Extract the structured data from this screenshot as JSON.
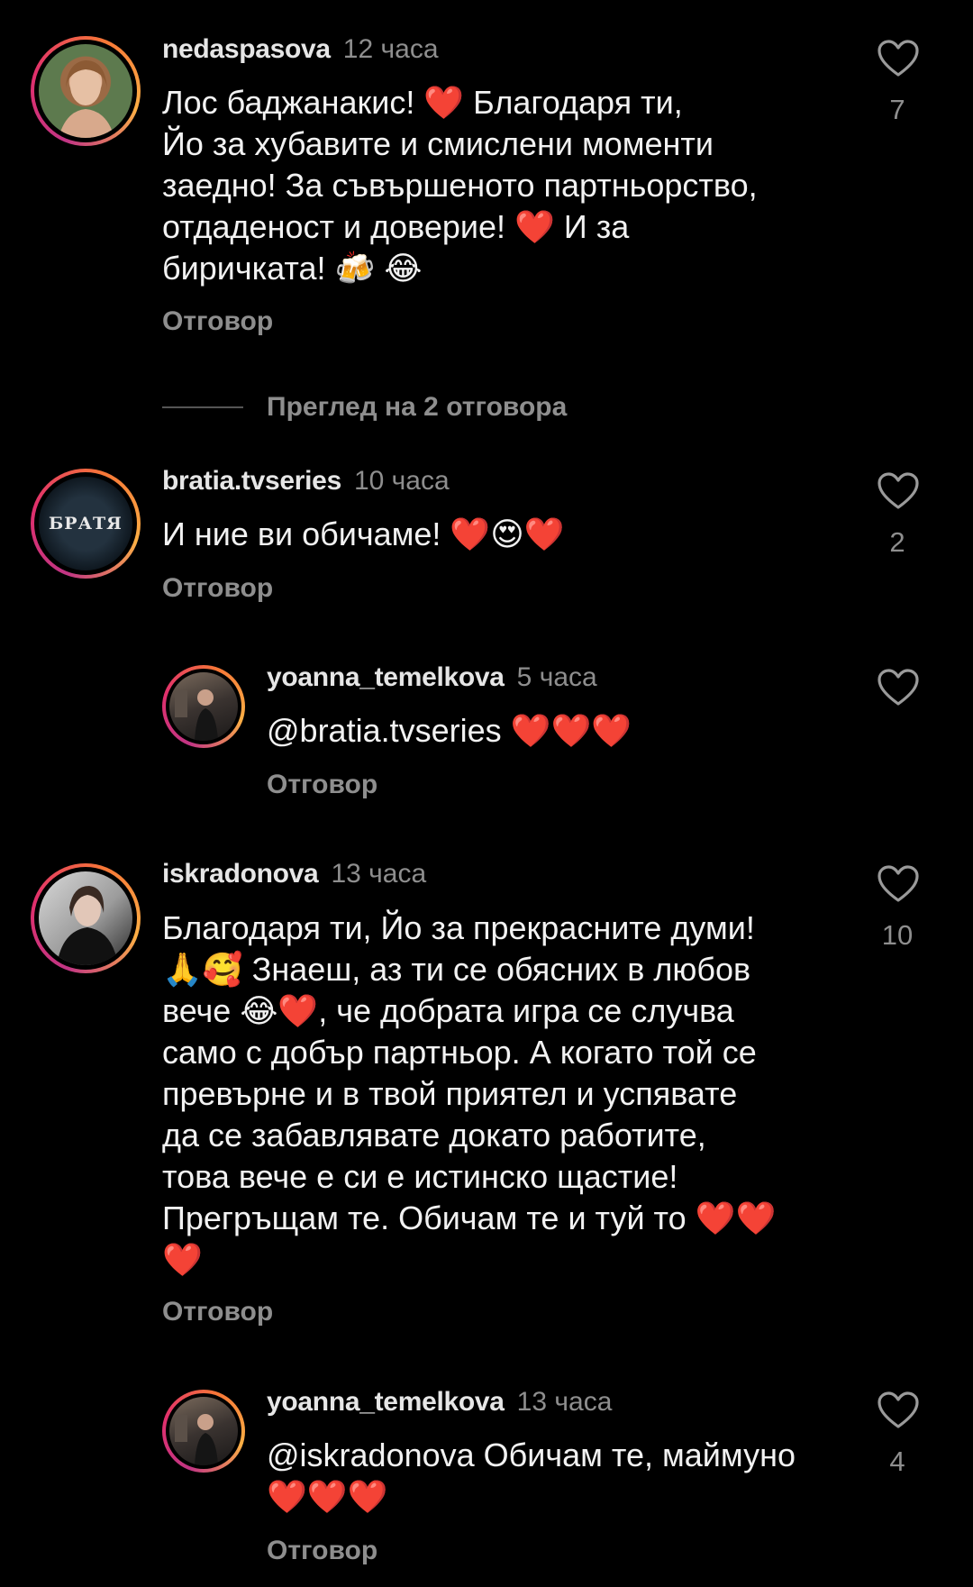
{
  "comments": [
    {
      "username": "nedaspasova",
      "time": "12 часа",
      "lines": [
        "Лос баджанакис! ❤️ Благодаря ти,",
        "Йо за хубавите и смислени моменти",
        "заедно! За съвършеното партньорство,",
        "отдаденост и доверие! ❤️ И за",
        "биричката! 🍻 😂"
      ],
      "reply_label": "Отговор",
      "likes": "7"
    },
    {
      "username": "bratia.tvseries",
      "time": "10 часа",
      "avatar_text": "БРАТЯ",
      "lines": [
        "И ние ви обичаме! ❤️😍❤️"
      ],
      "reply_label": "Отговор",
      "likes": "2"
    },
    {
      "username": "yoanna_temelkova",
      "time": "5 часа",
      "lines": [
        "@bratia.tvseries ❤️❤️❤️"
      ],
      "reply_label": "Отговор",
      "likes": ""
    },
    {
      "username": "iskradonova",
      "time": "13 часа",
      "lines": [
        "Благодаря ти, Йо за прекрасните думи!",
        "🙏🥰 Знаеш, аз ти се обясних в любов",
        "вече 😂❤️, че добрата игра се случва",
        "само с добър партньор. А когато той се",
        "превърне и в твой приятел и успявате",
        "да се забавлявате докато работите,",
        "това вече е си е истинско щастие!",
        "Прегръщам те. Обичам те и туй то ❤️❤️",
        "❤️"
      ],
      "reply_label": "Отговор",
      "likes": "10"
    },
    {
      "username": "yoanna_temelkova",
      "time": "13 часа",
      "lines": [
        "@iskradonova Обичам те, маймуно",
        "❤️❤️❤️"
      ],
      "reply_label": "Отговор",
      "likes": "4"
    }
  ],
  "view_replies": "Преглед на 2 отговора",
  "icons": {
    "like": "heart-outline-icon"
  },
  "colors": {
    "background": "#000000",
    "text": "#f2f2f2",
    "muted": "#8e8e8e",
    "heart": "#e0162b"
  }
}
